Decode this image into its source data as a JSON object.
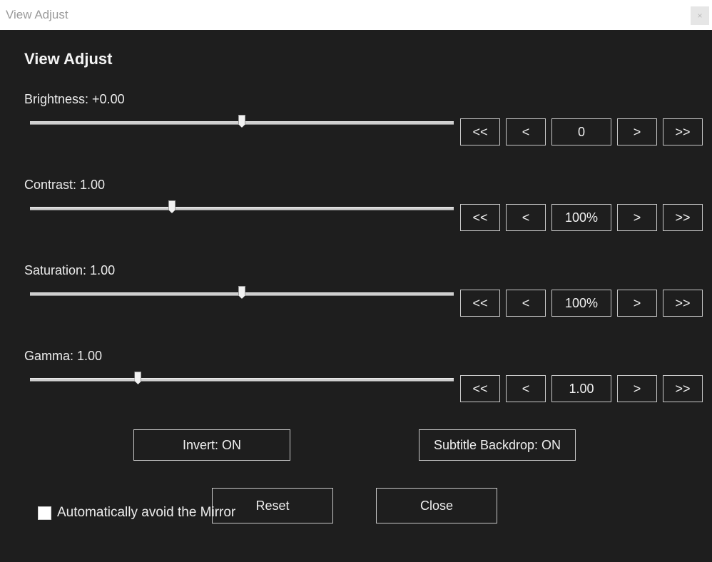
{
  "window": {
    "title": "View Adjust",
    "close_glyph": "×"
  },
  "heading": "View Adjust",
  "controls": [
    {
      "label": "Brightness: +0.00",
      "value": "0",
      "level": 0.5,
      "step_btns": [
        "<<",
        "<",
        ">",
        ">>"
      ]
    },
    {
      "label": "Contrast: 1.00",
      "value": "100%",
      "level": 0.335,
      "step_btns": [
        "<<",
        "<",
        ">",
        ">>"
      ]
    },
    {
      "label": "Saturation: 1.00",
      "value": "100%",
      "level": 0.5,
      "step_btns": [
        "<<",
        "<",
        ">",
        ">>"
      ]
    },
    {
      "label": "Gamma: 1.00",
      "value": "1.00",
      "level": 0.255,
      "step_btns": [
        "<<",
        "<",
        ">",
        ">>"
      ]
    }
  ],
  "toggles": {
    "invert": "Invert: ON",
    "subtitle_backdrop": "Subtitle Backdrop: ON"
  },
  "actions": {
    "reset": "Reset",
    "close": "Close"
  },
  "option": {
    "label": "Automatically avoid the Mirror",
    "checked": false
  }
}
